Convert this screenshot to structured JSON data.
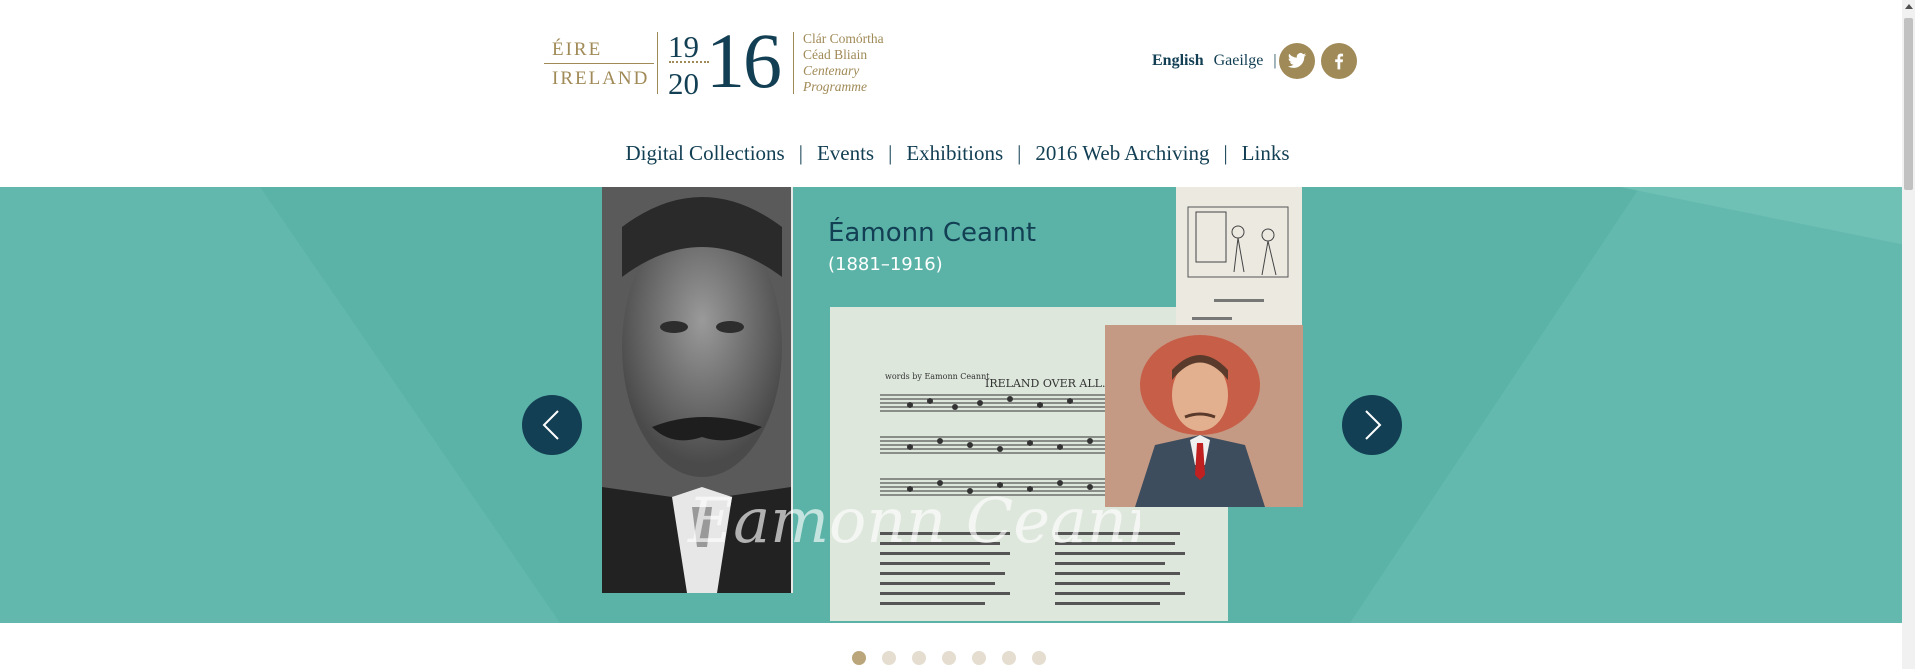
{
  "logo": {
    "eire": "ÉIRE",
    "ireland": "IRELAND",
    "year_top": "19",
    "year_bottom": "20",
    "year_big": "16",
    "programme_line1": "Clár Comórtha",
    "programme_line2": "Céad Bliain",
    "programme_line3": "Centenary",
    "programme_line4": "Programme"
  },
  "language": {
    "english": "English",
    "irish": "Gaeilge",
    "separator": "|"
  },
  "social": {
    "twitter_icon": "twitter-icon",
    "facebook_icon": "facebook-icon"
  },
  "nav": {
    "items": [
      "Digital Collections",
      "Events",
      "Exhibitions",
      "2016 Web Archiving",
      "Links"
    ],
    "separator": "|"
  },
  "slide": {
    "name": "Éamonn Ceannt",
    "dates": "(1881–1916)",
    "sheet_heading": "IRELAND OVER ALL.",
    "sheet_credit": "words by Eamonn Ceannt",
    "signature": "Eamonn Ceannt",
    "prev_icon": "chevron-left-icon",
    "next_icon": "chevron-right-icon"
  },
  "pagination": {
    "count": 7,
    "active_index": 0
  },
  "colors": {
    "brand_navy": "#123f53",
    "brand_gold": "#a08a57",
    "hero_teal": "#5bb3a8"
  }
}
